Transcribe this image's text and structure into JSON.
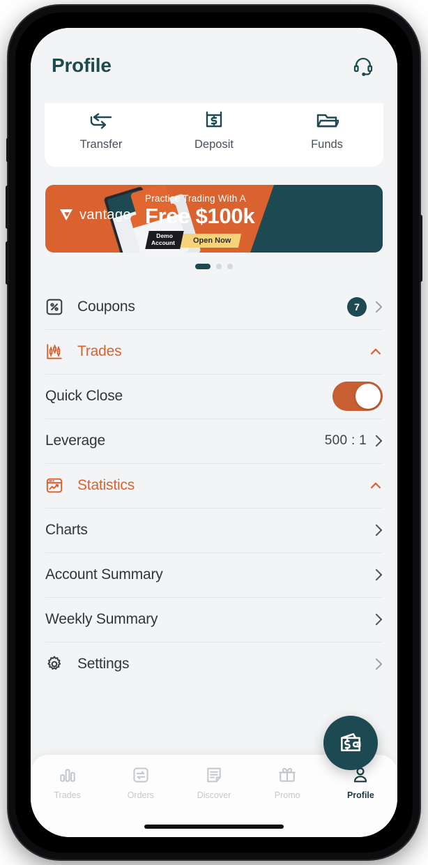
{
  "header": {
    "title": "Profile",
    "support_icon": "headset-icon"
  },
  "quick_actions": [
    {
      "label": "Transfer",
      "icon": "transfer-arrows-icon"
    },
    {
      "label": "Deposit",
      "icon": "deposit-dollar-icon"
    },
    {
      "label": "Funds",
      "icon": "funds-folder-icon"
    }
  ],
  "promo_banner": {
    "brand": "vantage",
    "headline_small": "Practice Trading With A",
    "headline_large": "Free $100k",
    "demo_tag_line1": "Demo",
    "demo_tag_line2": "Account",
    "cta": "Open Now",
    "bg_color": "#d9622f",
    "panel_color": "#1d4a52"
  },
  "carousel": {
    "total": 3,
    "active_index": 0
  },
  "menu": [
    {
      "id": "coupons",
      "label": "Coupons",
      "icon": "percent-box-icon",
      "badge": "7",
      "accent": false,
      "trailing": "chevron-right-icon"
    },
    {
      "id": "trades",
      "label": "Trades",
      "icon": "candlestick-chart-icon",
      "accent": true,
      "trailing": "chevron-up-icon"
    },
    {
      "id": "quick-close",
      "label": "Quick Close",
      "icon": null,
      "accent": false,
      "trailing": "toggle-switch",
      "toggle_on": true
    },
    {
      "id": "leverage",
      "label": "Leverage",
      "icon": null,
      "accent": false,
      "value": "500 : 1",
      "trailing": "chevron-right-icon"
    },
    {
      "id": "statistics",
      "label": "Statistics",
      "icon": "statistics-window-icon",
      "accent": true,
      "trailing": "chevron-up-icon"
    },
    {
      "id": "charts",
      "label": "Charts",
      "icon": null,
      "accent": false,
      "trailing": "chevron-right-icon"
    },
    {
      "id": "account-summary",
      "label": "Account Summary",
      "icon": null,
      "accent": false,
      "trailing": "chevron-right-icon"
    },
    {
      "id": "weekly-summary",
      "label": "Weekly Summary",
      "icon": null,
      "accent": false,
      "trailing": "chevron-right-icon"
    },
    {
      "id": "settings",
      "label": "Settings",
      "icon": "gear-icon",
      "accent": false,
      "trailing": "chevron-right-icon"
    }
  ],
  "fab": {
    "icon": "wallet-dollar-icon"
  },
  "bottom_nav": {
    "active": "Profile",
    "items": [
      {
        "label": "Trades",
        "icon": "bar-chart-icon"
      },
      {
        "label": "Orders",
        "icon": "orders-exchange-icon"
      },
      {
        "label": "Discover",
        "icon": "document-lines-icon"
      },
      {
        "label": "Promo",
        "icon": "gift-icon"
      },
      {
        "label": "Profile",
        "icon": "person-icon"
      }
    ]
  },
  "colors": {
    "accent_orange": "#d9622f",
    "brand_teal": "#1d4a52",
    "page_bg": "#f2f4f5",
    "card_bg": "#ffffff",
    "divider": "#e4e7e9",
    "muted_text": "#c3c9cd"
  }
}
